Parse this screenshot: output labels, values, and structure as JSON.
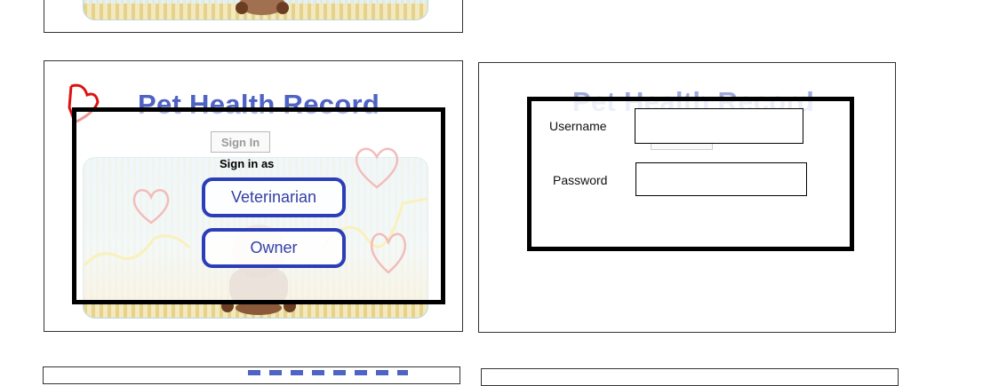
{
  "top_frame": {
    "name": "previous-screen-partial"
  },
  "left_screen": {
    "title": "Pet Health Record",
    "sign_in_button": "Sign In",
    "sign_in_as": "Sign in as",
    "options": [
      "Veterinarian",
      "Owner"
    ]
  },
  "right_screen": {
    "title": "Pet Health Record",
    "username_label": "Username",
    "password_label": "Password",
    "username_value": "",
    "password_value": ""
  },
  "colors": {
    "title_blue": "#4f63c4",
    "button_border_blue": "#2b3eb8",
    "heart_red": "#e26a6a"
  },
  "icons": [
    "heart-doodle-icon",
    "dog-doodle-icon"
  ]
}
